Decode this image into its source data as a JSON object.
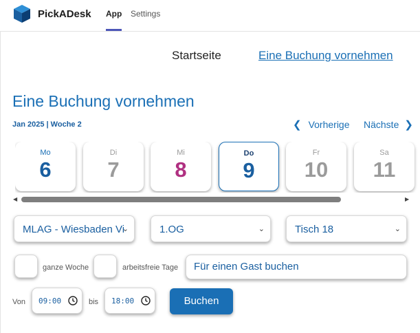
{
  "app": {
    "brand": "PickADesk"
  },
  "nav": {
    "app_label": "App",
    "settings_label": "Settings"
  },
  "subnav": {
    "home_label": "Startseite",
    "booking_label": "Eine Buchung vornehmen"
  },
  "page": {
    "title": "Eine Buchung vornehmen",
    "week_label": "Jan 2025 | Woche 2"
  },
  "pager": {
    "prev_label": "Vorherige",
    "next_label": "Nächste"
  },
  "days": [
    {
      "name": "Mo",
      "number": "6",
      "state": "available"
    },
    {
      "name": "Di",
      "number": "7",
      "state": "disabled"
    },
    {
      "name": "Mi",
      "number": "8",
      "state": "today"
    },
    {
      "name": "Do",
      "number": "9",
      "state": "selected"
    },
    {
      "name": "Fr",
      "number": "10",
      "state": "disabled"
    },
    {
      "name": "Sa",
      "number": "11",
      "state": "disabled"
    }
  ],
  "selects": {
    "location": "MLAG - Wiesbaden Vi",
    "floor": "1.OG",
    "desk": "Tisch 18"
  },
  "options": {
    "whole_week_label": "ganze Woche",
    "free_days_label": "arbeitsfreie Tage",
    "guest_label": "Für einen Gast buchen"
  },
  "time": {
    "from_label": "Von",
    "from_value": "09:00",
    "to_label": "bis",
    "to_value": "18:00"
  },
  "actions": {
    "book_label": "Buchen"
  },
  "colors": {
    "accent": "#1a6fb5",
    "today": "#b03081",
    "nav_underline": "#4d57b8",
    "muted": "#9b9b9b"
  },
  "icons": {
    "logo": "pickadesk-logo-icon",
    "prev": "chevron-left-icon",
    "next": "chevron-right-icon",
    "select": "chevron-down-icon",
    "time": "clock-icon"
  }
}
